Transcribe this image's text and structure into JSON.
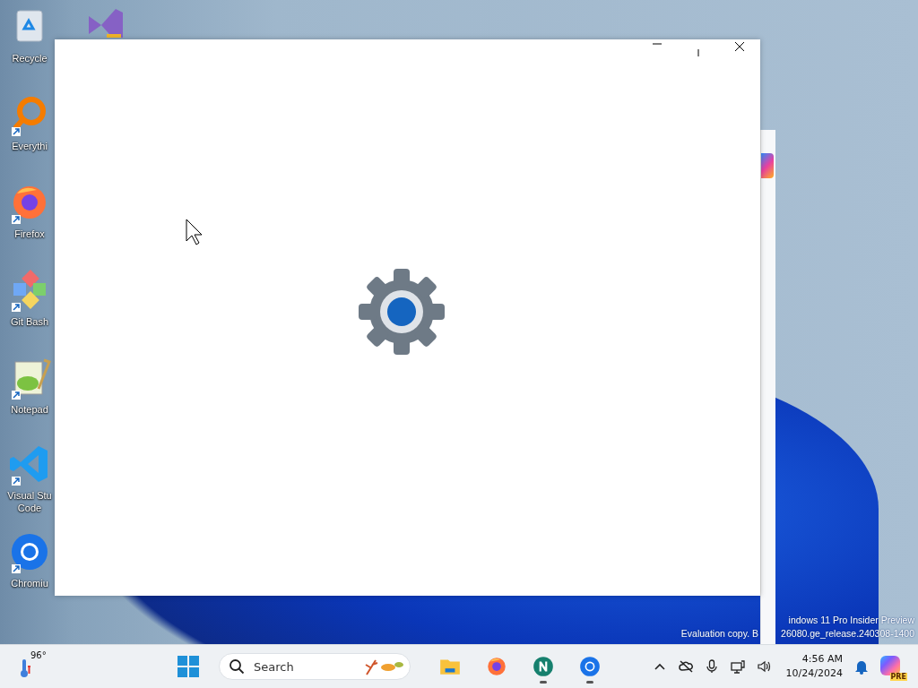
{
  "desktop_icons": [
    {
      "kind": "recycle",
      "label": "Recycle",
      "shortcut": false
    },
    {
      "kind": "vs",
      "shortcut": false
    },
    {
      "kind": "everything",
      "label": "Everythi",
      "shortcut": true
    },
    {
      "kind": "firefox",
      "label": "Firefox",
      "shortcut": true
    },
    {
      "kind": "git",
      "label": "Git Bash",
      "shortcut": true
    },
    {
      "kind": "notepad",
      "label": "Notepad",
      "shortcut": true
    },
    {
      "kind": "vscode",
      "label": "Visual Stu Code",
      "shortcut": true
    },
    {
      "kind": "chromium",
      "label": "Chromiu",
      "shortcut": true
    }
  ],
  "watermark": {
    "line_1": "indows 11 Pro Insider Preview",
    "line_2_left": "Evaluation copy. B",
    "line_2_right": "26080.ge_release.240308-1400"
  },
  "window": {
    "controls": [
      {
        "kind": "minimize"
      },
      {
        "kind": "maximize"
      },
      {
        "kind": "close"
      }
    ],
    "loading": true
  },
  "taskbar": {
    "weather": "96°",
    "search": {
      "placeholder": "Search"
    },
    "apps": [
      {
        "kind": "explorer",
        "running": false
      },
      {
        "kind": "firefox",
        "running": false
      },
      {
        "kind": "netscape",
        "running": true
      },
      {
        "kind": "chromium",
        "running": true
      }
    ],
    "tray": [
      {
        "kind": "chevron"
      },
      {
        "kind": "cloud"
      },
      {
        "kind": "mic"
      },
      {
        "kind": "network"
      },
      {
        "kind": "speaker"
      }
    ],
    "time": "4:56 AM",
    "date": "10/24/2024",
    "copilot_badge": "PRE"
  }
}
